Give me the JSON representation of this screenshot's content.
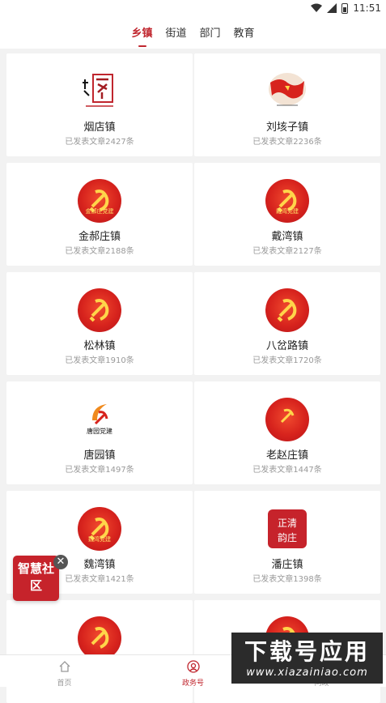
{
  "status_bar": {
    "time": "11:51"
  },
  "tabs": [
    {
      "label": "乡镇",
      "active": true
    },
    {
      "label": "街道",
      "active": false
    },
    {
      "label": "部门",
      "active": false
    },
    {
      "label": "教育",
      "active": false
    }
  ],
  "cards": [
    {
      "name": "烟店镇",
      "count": "已发表文章2427条",
      "logo": "yandian-calligraphy-icon",
      "logo_text": "山东 烟店"
    },
    {
      "name": "刘垓子镇",
      "count": "已发表文章2236条",
      "logo": "red-flag-icon"
    },
    {
      "name": "金郝庄镇",
      "count": "已发表文章2188条",
      "logo": "party-emblem-icon",
      "logo_text": "金郝庄党建"
    },
    {
      "name": "戴湾镇",
      "count": "已发表文章2127条",
      "logo": "party-emblem-icon",
      "logo_text": "戴湾党建"
    },
    {
      "name": "松林镇",
      "count": "已发表文章1910条",
      "logo": "party-emblem-icon",
      "logo_text": ""
    },
    {
      "name": "八岔路镇",
      "count": "已发表文章1720条",
      "logo": "party-emblem-icon",
      "logo_text": ""
    },
    {
      "name": "唐园镇",
      "count": "已发表文章1497条",
      "logo": "tangyuan-party-building-icon",
      "logo_text": "唐园党建"
    },
    {
      "name": "老赵庄镇",
      "count": "已发表文章1447条",
      "logo": "party-emblem-icon",
      "logo_text": ""
    },
    {
      "name": "魏湾镇",
      "count": "已发表文章1421条",
      "logo": "party-emblem-icon",
      "logo_text": "魏湾党建"
    },
    {
      "name": "潘庄镇",
      "count": "已发表文章1398条",
      "logo": "panzhuang-seal-icon",
      "logo_text": "正清韵庄"
    },
    {
      "name": "",
      "count": "",
      "logo": "party-emblem-icon",
      "logo_text": ""
    },
    {
      "name": "",
      "count": "",
      "logo": "party-emblem-icon",
      "logo_text": ""
    }
  ],
  "float_badge": {
    "label": "智慧社区",
    "close": "✕"
  },
  "watermark": {
    "title": "下载号应用",
    "url": "www.xiazainiao.com"
  },
  "bottom_nav": [
    {
      "label": "首页",
      "icon": "home-icon",
      "active": false
    },
    {
      "label": "政务号",
      "icon": "government-account-icon",
      "active": true
    },
    {
      "label": "问政",
      "icon": "question-icon",
      "active": false
    }
  ],
  "colors": {
    "accent": "#c0262e",
    "emblem_red": "#d7231d",
    "emblem_gold": "#ffd54a"
  }
}
